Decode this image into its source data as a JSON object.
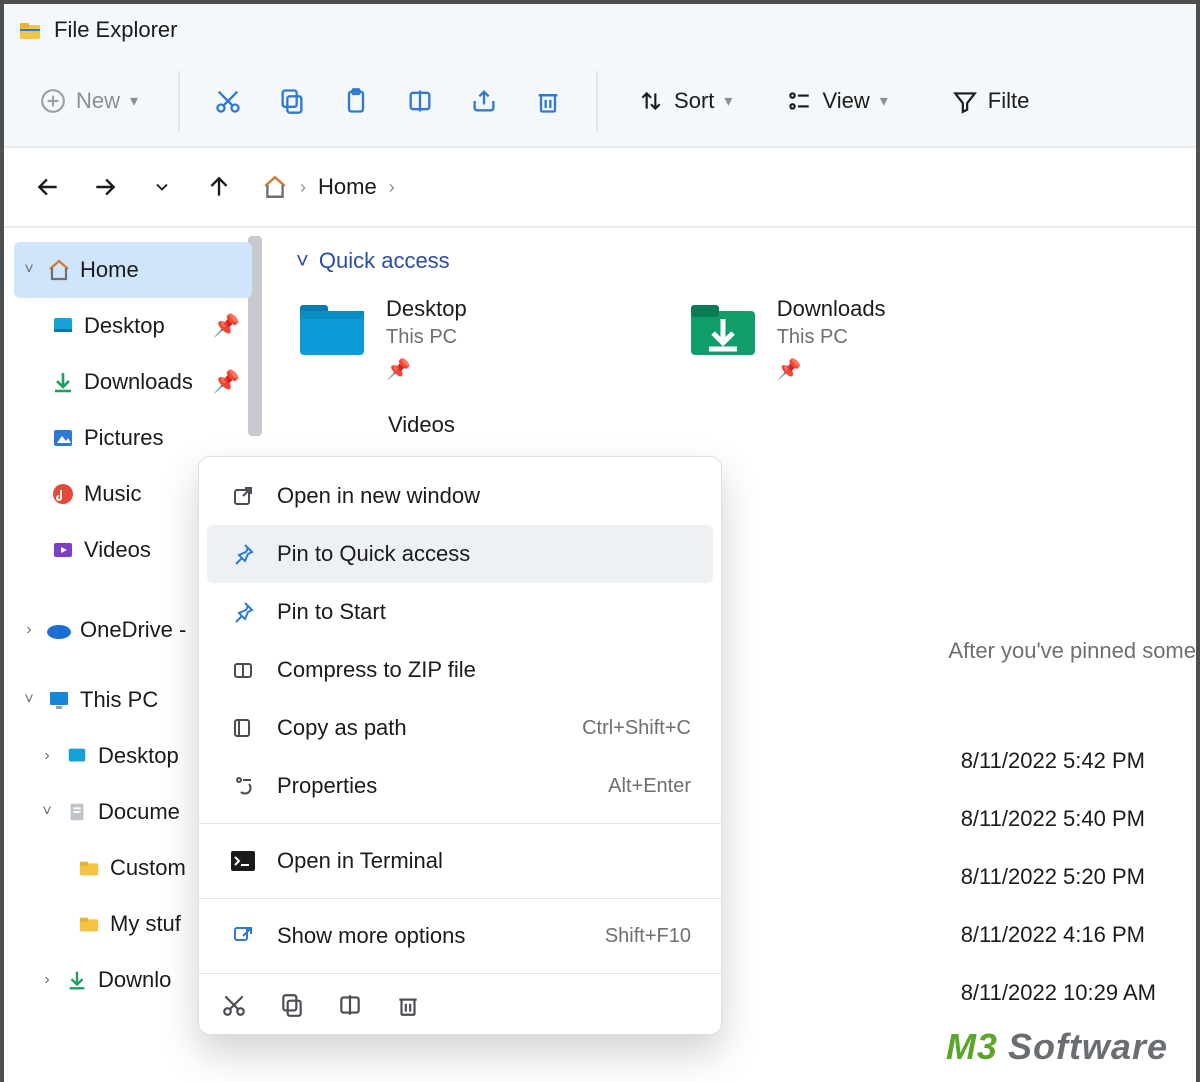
{
  "window": {
    "title": "File Explorer"
  },
  "toolbar": {
    "new_label": "New",
    "sort_label": "Sort",
    "view_label": "View",
    "filter_label": "Filte"
  },
  "breadcrumb": {
    "segments": [
      "Home"
    ]
  },
  "sidebar": {
    "items": [
      {
        "label": "Home",
        "expanded": true,
        "selected": true
      },
      {
        "label": "Desktop",
        "pinned": true
      },
      {
        "label": "Downloads",
        "pinned": true
      },
      {
        "label": "Pictures"
      },
      {
        "label": "Music"
      },
      {
        "label": "Videos"
      },
      {
        "label": "OneDrive -"
      },
      {
        "label": "This PC",
        "expanded": true
      },
      {
        "label": "Desktop"
      },
      {
        "label": "Docume",
        "expanded": true
      },
      {
        "label": "Custom"
      },
      {
        "label": "My stuf"
      },
      {
        "label": "Downlo"
      }
    ]
  },
  "content": {
    "section_label": "Quick access",
    "items": [
      {
        "title": "Desktop",
        "subtitle": "This PC"
      },
      {
        "title": "Downloads",
        "subtitle": "This PC"
      }
    ],
    "peek_label": "Videos",
    "pinned_hint": "After you've pinned some",
    "dates": [
      "8/11/2022 5:42 PM",
      "8/11/2022 5:40 PM",
      "8/11/2022 5:20 PM",
      "8/11/2022 4:16 PM",
      "8/11/2022 10:29 AM"
    ]
  },
  "context_menu": {
    "items": [
      {
        "label": "Open in new window"
      },
      {
        "label": "Pin to Quick access",
        "highlight": true
      },
      {
        "label": "Pin to Start"
      },
      {
        "label": "Compress to ZIP file"
      },
      {
        "label": "Copy as path",
        "shortcut": "Ctrl+Shift+C"
      },
      {
        "label": "Properties",
        "shortcut": "Alt+Enter"
      },
      {
        "label": "Open in Terminal",
        "section": true
      },
      {
        "label": "Show more options",
        "shortcut": "Shift+F10",
        "section": true
      }
    ]
  },
  "watermark": {
    "m3": "M3",
    "software": "Software"
  }
}
